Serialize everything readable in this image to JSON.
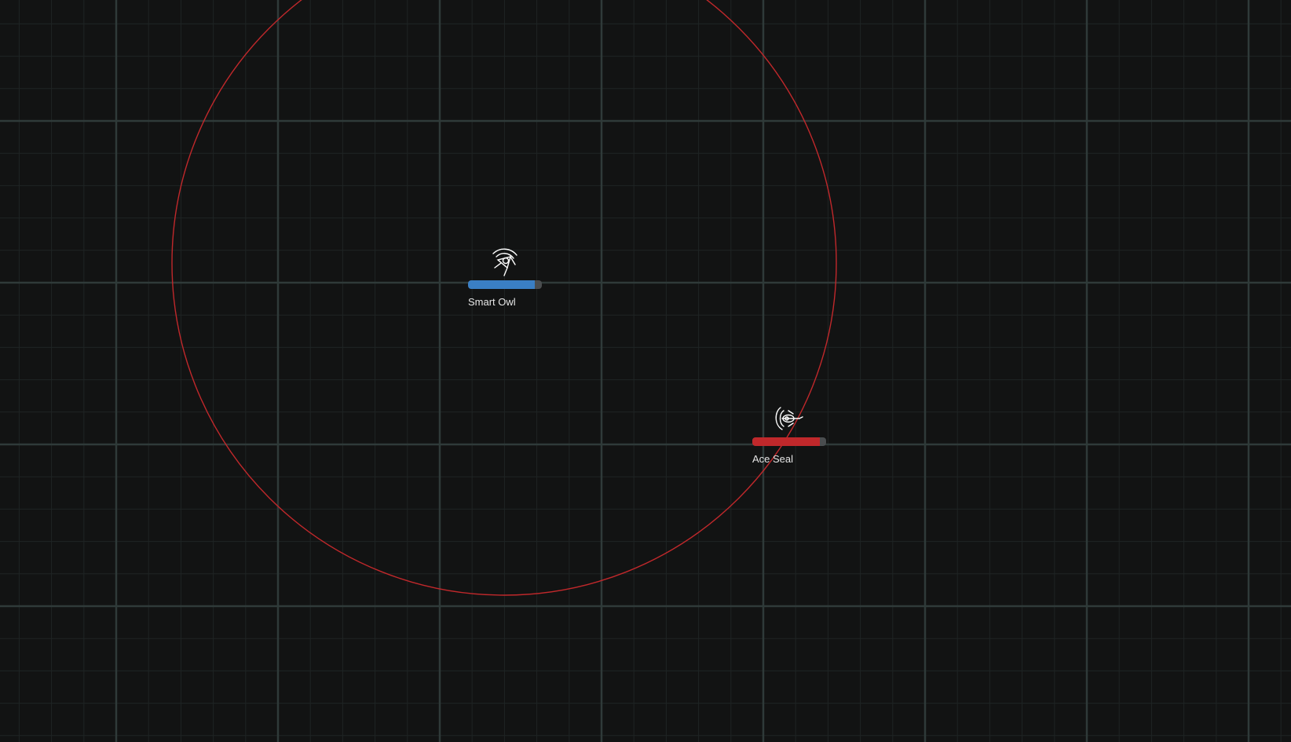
{
  "arena": {
    "background_color": "#121313",
    "grid_minor_color": "#1f2424",
    "grid_major_color": "#2f3a39",
    "range_ring_color": "#c0282b"
  },
  "units": [
    {
      "id": "smart-owl",
      "name": "Smart Owl",
      "team": "blue",
      "health_fraction": 0.9,
      "bar_color": "#3a7fc4",
      "icon": "fighter-ship-icon",
      "has_range_ring": true
    },
    {
      "id": "ace-seal",
      "name": "Ace Seal",
      "team": "red",
      "health_fraction": 0.91,
      "bar_color": "#c0282b",
      "icon": "fighter-ship-icon",
      "has_range_ring": false
    }
  ]
}
